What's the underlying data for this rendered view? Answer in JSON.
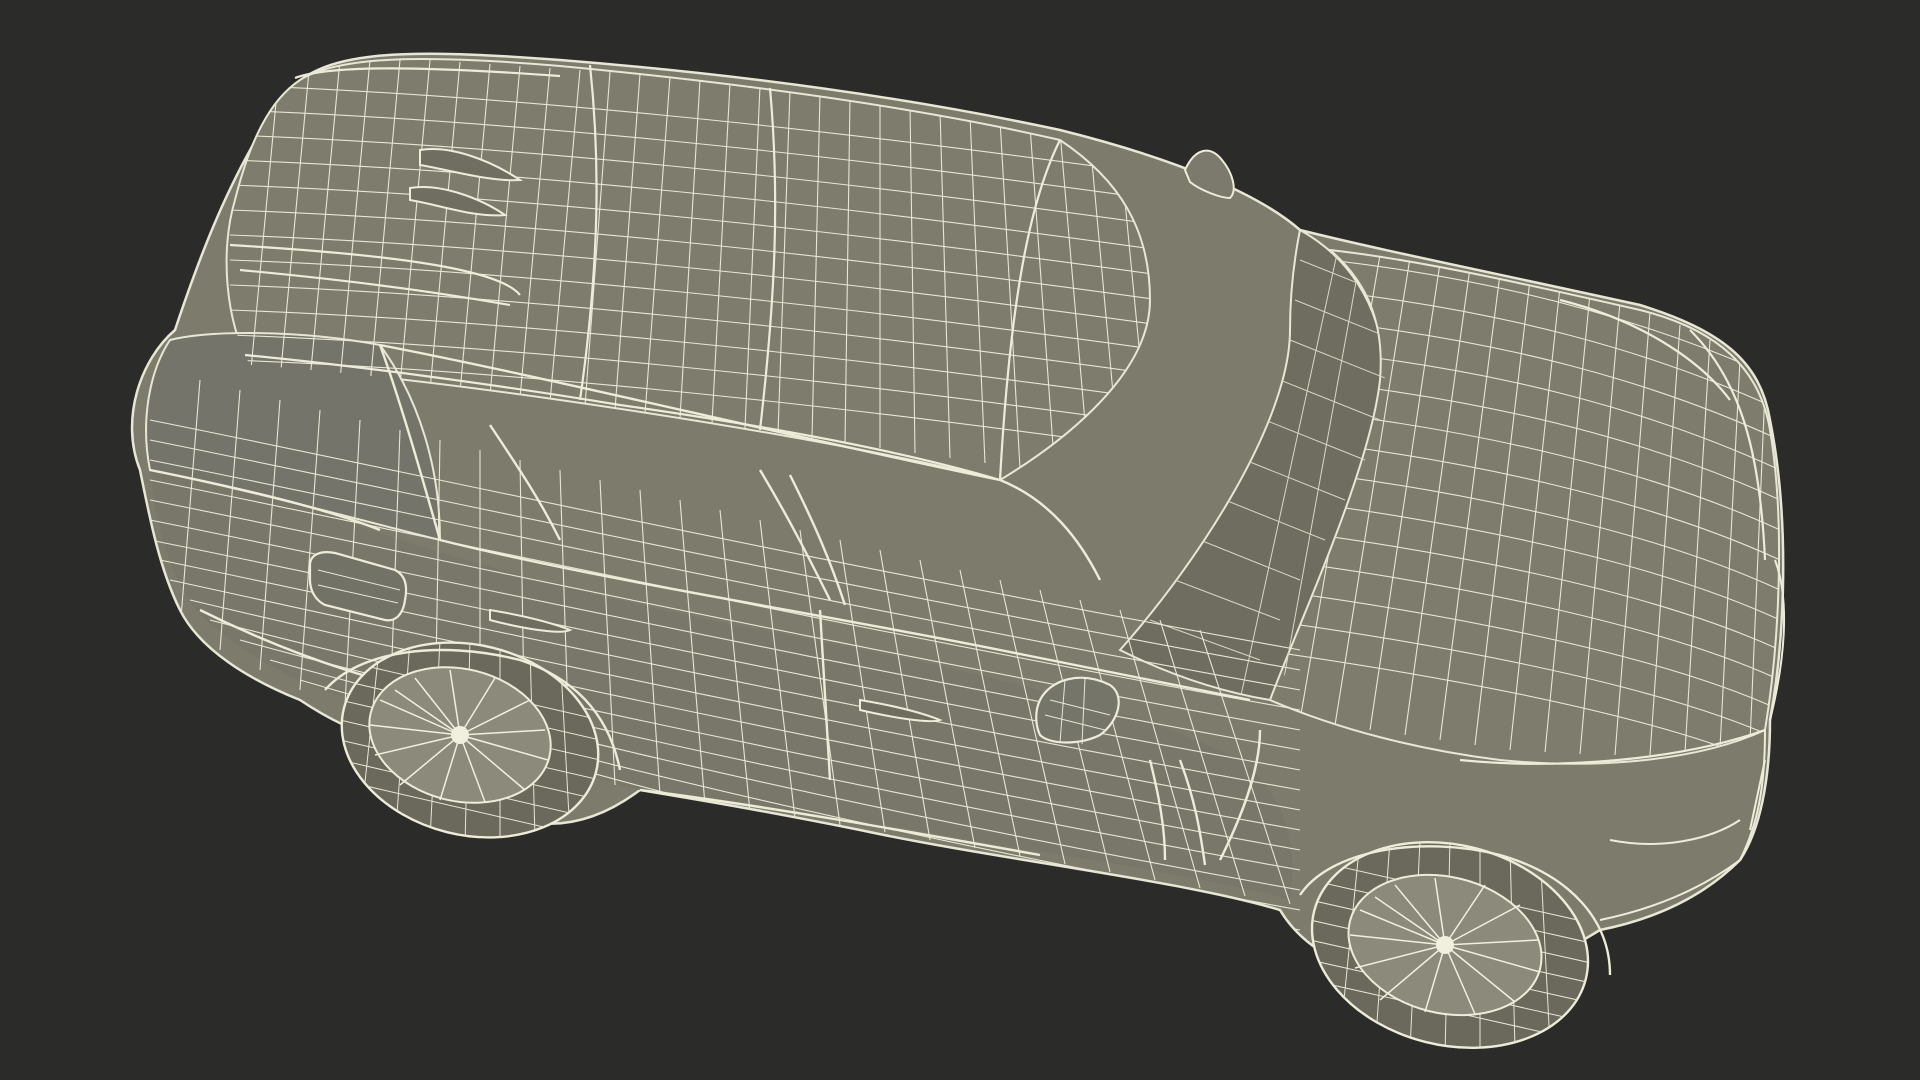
{
  "scene": {
    "subject": "wireframe-car",
    "colors": {
      "background": "#2b2b29",
      "surface": "#7c7b6c",
      "surface_dark": "#6c6b5d",
      "surface_light": "#8a897a",
      "wire": "#e8e6d4",
      "wire_dim": "#cfcdb9",
      "tire": "#6a695c",
      "rim": "#8b8a7b"
    }
  }
}
